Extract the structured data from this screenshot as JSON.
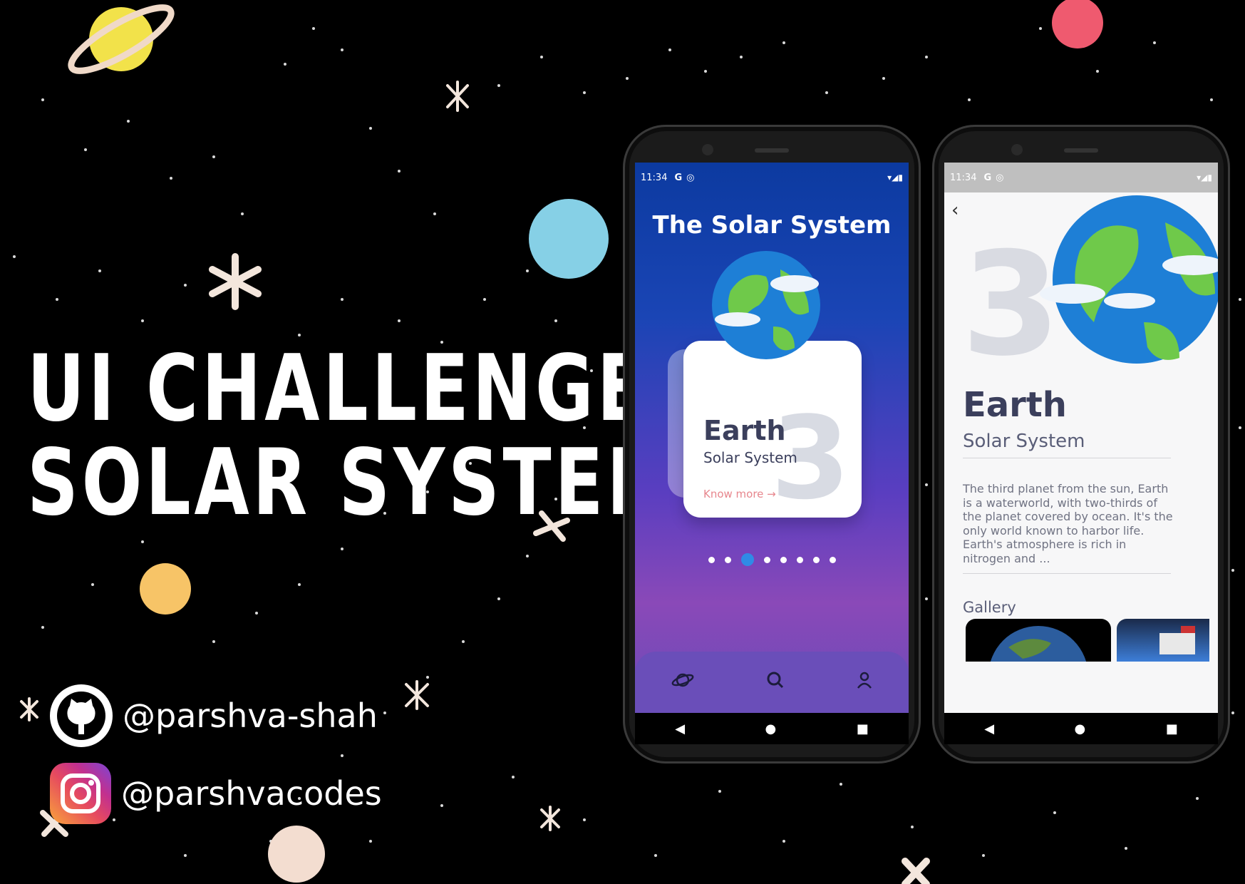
{
  "headline": {
    "line1": "UI CHALLENGE",
    "line2": "SOLAR SYSTEM"
  },
  "social": {
    "github_handle": "@parshva-shah",
    "instagram_handle": "@parshvacodes",
    "github_icon": "github-icon",
    "instagram_icon": "instagram-icon"
  },
  "colors": {
    "background": "#000000",
    "accent_blue": "#2f8be6",
    "card_link": "#e7868d",
    "planet_yellow": "#f2e24a",
    "planet_red": "#ef5a6f",
    "planet_cyan": "#86d0e6",
    "planet_orange": "#f7c467"
  },
  "phone1": {
    "status": {
      "time": "11:34",
      "g_label": "G"
    },
    "title": "The Solar System",
    "card": {
      "name": "Earth",
      "subtitle": "Solar System",
      "number": "3",
      "link": "Know more →"
    },
    "pager": {
      "count": 8,
      "active_index": 2
    },
    "bottom_nav": [
      "planet-icon",
      "search-icon",
      "profile-icon"
    ],
    "system_nav": [
      "◀",
      "●",
      "■"
    ]
  },
  "phone2": {
    "status": {
      "time": "11:34",
      "g_label": "G"
    },
    "back": "‹",
    "number": "3",
    "name": "Earth",
    "subtitle": "Solar System",
    "description": "The third planet from the sun, Earth is a waterworld, with two-thirds of the planet covered by ocean. It's the only world known to harbor life. Earth's atmosphere is rich in nitrogen and ...",
    "gallery_label": "Gallery",
    "system_nav": [
      "◀",
      "●",
      "■"
    ]
  }
}
